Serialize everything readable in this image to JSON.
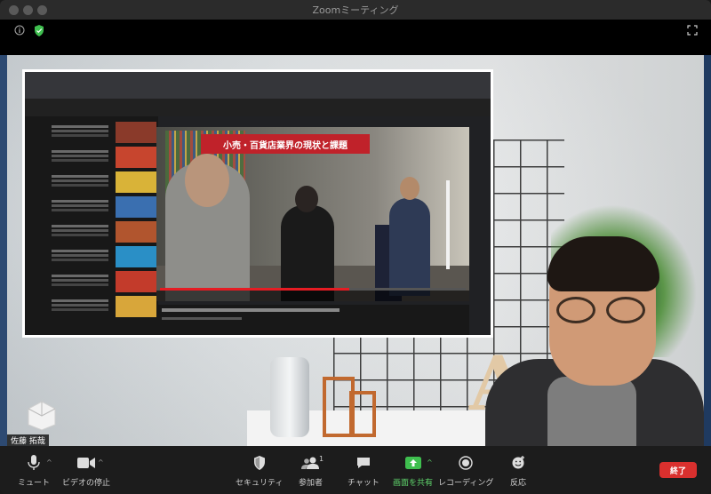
{
  "window": {
    "title": "Zoomミーティング"
  },
  "participant": {
    "name": "佐藤 拓哉"
  },
  "shared_video": {
    "banner": "小売・百貨店業界の現状と課題",
    "progress": 0.62
  },
  "toolbar": {
    "mute": "ミュート",
    "stop_video": "ビデオの停止",
    "security": "セキュリティ",
    "participants": "参加者",
    "participant_count": "1",
    "chat": "チャット",
    "share_screen": "画面を共有",
    "record": "レコーディング",
    "reactions": "反応",
    "end": "終了"
  },
  "colors": {
    "end_button": "#d9302e",
    "share_green": "#5fd36b",
    "security_shield": "#3fbf4f"
  }
}
